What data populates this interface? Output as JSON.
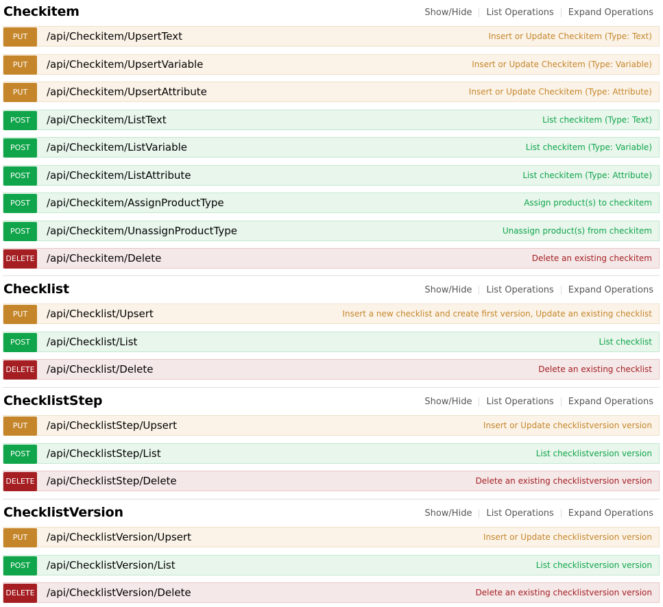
{
  "groups": [
    {
      "title": "Checkitem",
      "links": [
        "Show/Hide",
        "List Operations",
        "Expand Operations"
      ],
      "ops": [
        {
          "method": "PUT",
          "cls": "put",
          "path": "/api/Checkitem/UpsertText",
          "summary": "Insert or Update Checkitem (Type: Text)"
        },
        {
          "method": "PUT",
          "cls": "put",
          "path": "/api/Checkitem/UpsertVariable",
          "summary": "Insert or Update Checkitem (Type: Variable)"
        },
        {
          "method": "PUT",
          "cls": "put",
          "path": "/api/Checkitem/UpsertAttribute",
          "summary": "Insert or Update Checkitem (Type: Attribute)"
        },
        {
          "method": "POST",
          "cls": "post",
          "path": "/api/Checkitem/ListText",
          "summary": "List checkitem (Type: Text)"
        },
        {
          "method": "POST",
          "cls": "post",
          "path": "/api/Checkitem/ListVariable",
          "summary": "List checkitem (Type: Variable)"
        },
        {
          "method": "POST",
          "cls": "post",
          "path": "/api/Checkitem/ListAttribute",
          "summary": "List checkitem (Type: Attribute)"
        },
        {
          "method": "POST",
          "cls": "post",
          "path": "/api/Checkitem/AssignProductType",
          "summary": "Assign product(s) to checkitem"
        },
        {
          "method": "POST",
          "cls": "post",
          "path": "/api/Checkitem/UnassignProductType",
          "summary": "Unassign product(s) from checkitem"
        },
        {
          "method": "DELETE",
          "cls": "delete",
          "path": "/api/Checkitem/Delete",
          "summary": "Delete an existing checkitem"
        }
      ]
    },
    {
      "title": "Checklist",
      "links": [
        "Show/Hide",
        "List Operations",
        "Expand Operations"
      ],
      "ops": [
        {
          "method": "PUT",
          "cls": "put",
          "path": "/api/Checklist/Upsert",
          "summary": "Insert a new checklist and create first version, Update an existing checklist"
        },
        {
          "method": "POST",
          "cls": "post",
          "path": "/api/Checklist/List",
          "summary": "List checklist"
        },
        {
          "method": "DELETE",
          "cls": "delete",
          "path": "/api/Checklist/Delete",
          "summary": "Delete an existing checklist"
        }
      ]
    },
    {
      "title": "ChecklistStep",
      "links": [
        "Show/Hide",
        "List Operations",
        "Expand Operations"
      ],
      "ops": [
        {
          "method": "PUT",
          "cls": "put",
          "path": "/api/ChecklistStep/Upsert",
          "summary": "Insert or Update checklistversion version"
        },
        {
          "method": "POST",
          "cls": "post",
          "path": "/api/ChecklistStep/List",
          "summary": "List checklistversion version"
        },
        {
          "method": "DELETE",
          "cls": "delete",
          "path": "/api/ChecklistStep/Delete",
          "summary": "Delete an existing checklistversion version"
        }
      ]
    },
    {
      "title": "ChecklistVersion",
      "links": [
        "Show/Hide",
        "List Operations",
        "Expand Operations"
      ],
      "ops": [
        {
          "method": "PUT",
          "cls": "put",
          "path": "/api/ChecklistVersion/Upsert",
          "summary": "Insert or Update checklistversion version"
        },
        {
          "method": "POST",
          "cls": "post",
          "path": "/api/ChecklistVersion/List",
          "summary": "List checklistversion version"
        },
        {
          "method": "DELETE",
          "cls": "delete",
          "path": "/api/ChecklistVersion/Delete",
          "summary": "Delete an existing checklistversion version"
        }
      ]
    }
  ],
  "colors": {
    "put": "#c5862b",
    "post": "#10a54a",
    "delete": "#a41e22"
  }
}
